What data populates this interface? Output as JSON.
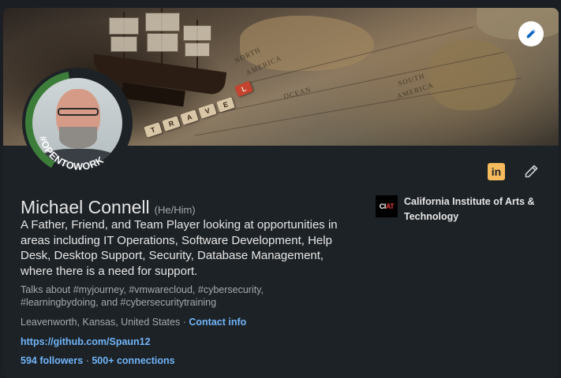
{
  "profile": {
    "name": "Michael Connell",
    "pronouns": "(He/Him)",
    "headline": "A Father, Friend, and Team Player looking at opportunities in areas including IT Operations, Software Development, Help Desk, Desktop Support, Security, Database Management, where there is a need for support.",
    "talks_about": "Talks about #myjourney, #vmwarecloud, #cybersecurity, #learningbydoing, and #cybersecuritytraining",
    "location": "Leavenworth, Kansas, United States",
    "location_separator": "·",
    "contact_info_label": "Contact info",
    "website": "https://github.com/Spaun12",
    "followers": "594 followers",
    "connections_separator": "·",
    "connections": "500+ connections",
    "open_to_work_badge": "#OPENTOWORK"
  },
  "education": {
    "school_name": "California Institute of Arts & Technology",
    "logo_text_left": "CI",
    "logo_text_right": "AT"
  },
  "banner": {
    "map_labels": [
      "NORTH",
      "AMERICA",
      "OCEAN",
      "SOUTH",
      "AMERICA"
    ],
    "tiles": [
      "T",
      "R",
      "A",
      "V",
      "E",
      "L"
    ]
  },
  "icons": {
    "edit_cover": "pencil-icon",
    "linkedin": "linkedin-icon",
    "linkedin_glyph": "in",
    "edit_profile": "pencil-icon"
  },
  "colors": {
    "background": "#1d2226",
    "text_primary": "#e6e6e6",
    "text_secondary": "#a4a9ad",
    "link": "#70b5f9",
    "open_to_work_green": "#3c7d39",
    "linkedin_badge": "#f5bb5c"
  }
}
